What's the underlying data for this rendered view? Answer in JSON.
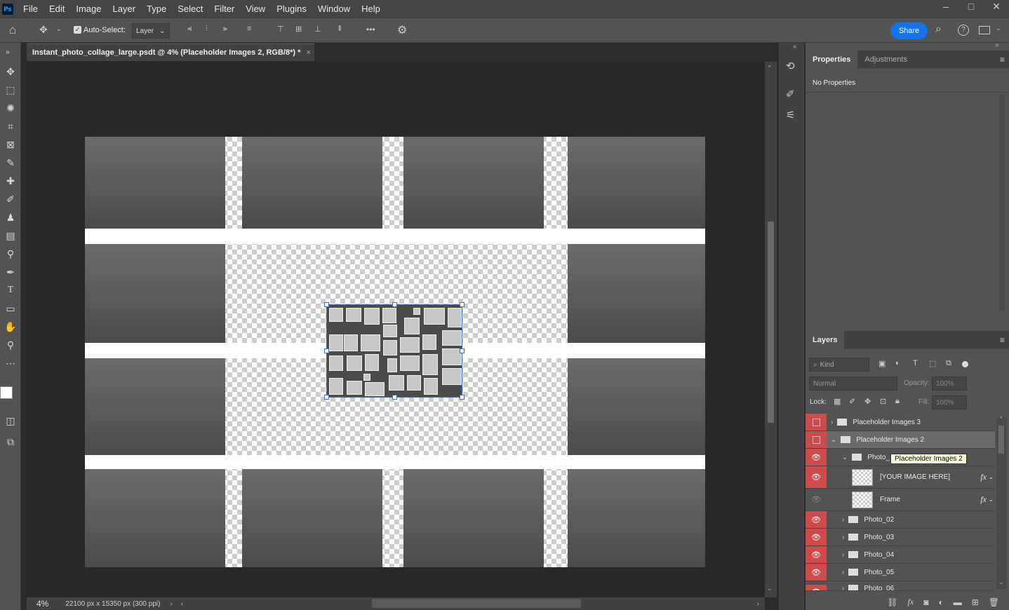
{
  "app": {
    "logo": "Ps"
  },
  "menu": [
    "File",
    "Edit",
    "Image",
    "Layer",
    "Type",
    "Select",
    "Filter",
    "View",
    "Plugins",
    "Window",
    "Help"
  ],
  "window_controls": {
    "minimize": "–",
    "maximize": "□",
    "close": "✕"
  },
  "options": {
    "auto_select_label": "Auto-Select:",
    "auto_select_value": "Layer",
    "more_icon": "•••",
    "share_label": "Share"
  },
  "document": {
    "tab_title": "Instant_photo_collage_large.psdt @ 4% (Placeholder Images 2, RGB/8*) *",
    "close": "×"
  },
  "status": {
    "zoom": "4%",
    "info": "22100 px x 15350 px (300 ppi)"
  },
  "properties": {
    "tabs": [
      "Properties",
      "Adjustments"
    ],
    "content": "No Properties"
  },
  "layers_panel": {
    "tab": "Layers",
    "filter_placeholder": "Kind",
    "blend_mode": "Normal",
    "opacity_label": "Opacity:",
    "opacity_value": "100%",
    "lock_label": "Lock:",
    "fill_label": "Fill:",
    "fill_value": "100%",
    "tooltip": "Placeholder Images 2",
    "rows": [
      {
        "name": "Placeholder Images 3",
        "type": "group",
        "indent": 0,
        "visible": false,
        "expanded": false
      },
      {
        "name": "Placeholder Images 2",
        "type": "group",
        "indent": 0,
        "visible": false,
        "expanded": true,
        "selected": true
      },
      {
        "name": "Photo_",
        "type": "group",
        "indent": 1,
        "visible": true,
        "expanded": true
      },
      {
        "name": "[YOUR IMAGE HERE]",
        "type": "smart",
        "indent": 2,
        "visible": true,
        "fx": "fx"
      },
      {
        "name": "Frame",
        "type": "smart",
        "indent": 2,
        "visible": "dim",
        "fx": "fx"
      },
      {
        "name": "Photo_02",
        "type": "group",
        "indent": 1,
        "visible": true
      },
      {
        "name": "Photo_03",
        "type": "group",
        "indent": 1,
        "visible": true
      },
      {
        "name": "Photo_04",
        "type": "group",
        "indent": 1,
        "visible": true
      },
      {
        "name": "Photo_05",
        "type": "group",
        "indent": 1,
        "visible": true
      },
      {
        "name": "Photo_06",
        "type": "group",
        "indent": 1,
        "visible": true
      }
    ]
  }
}
